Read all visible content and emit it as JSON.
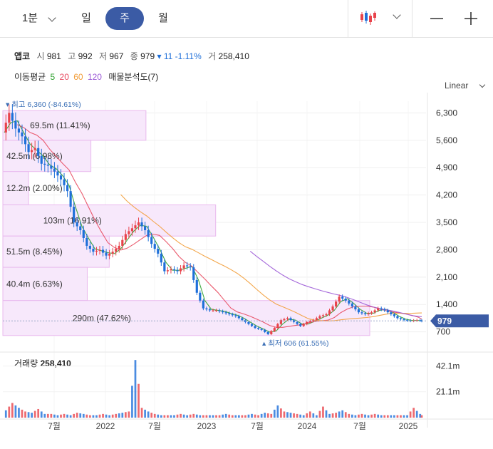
{
  "toolbar": {
    "interval_1m": "1분",
    "day": "일",
    "week": "주",
    "month": "월",
    "zoom_out": "—",
    "zoom_in": "+"
  },
  "stock": {
    "name": "앱코",
    "open_label": "시",
    "open": "981",
    "high_label": "고",
    "high": "992",
    "low_label": "저",
    "low": "967",
    "close_label": "종",
    "close": "979",
    "change": "▾ 11 -1.11%",
    "volume_label": "거",
    "volume": "258,410"
  },
  "ma": {
    "label": "이동평균",
    "periods": [
      {
        "value": "5",
        "color": "#2ca02c"
      },
      {
        "value": "20",
        "color": "#e84a5f"
      },
      {
        "value": "60",
        "color": "#f29d38"
      },
      {
        "value": "120",
        "color": "#9b59d6"
      }
    ],
    "profile_label": "매물분석도(7)"
  },
  "scale_mode": "Linear",
  "colors": {
    "up": "#e8434b",
    "down": "#1e6fd9",
    "profile": "#f7e8fb",
    "profile_border": "#e9b9ee",
    "accent": "#3b5ba5"
  },
  "chart_data": {
    "type": "candlestick",
    "x_ticks": [
      "7월",
      "2022",
      "7월",
      "2023",
      "7월",
      "2024",
      "7월",
      "2025"
    ],
    "price_axis": {
      "ticks": [
        "6,300",
        "5,600",
        "4,900",
        "4,200",
        "3,500",
        "2,800",
        "2,100",
        "1,400",
        "700"
      ],
      "ylim": [
        620,
        6600
      ]
    },
    "high_marker": {
      "text": "▾ 최고 6,360 (-84.61%)",
      "price": 6360
    },
    "low_marker": {
      "text": "▴ 최저 606 (61.55%)",
      "price": 606
    },
    "last_price": {
      "text": "979",
      "price": 979
    },
    "volume_profile": [
      {
        "label": "69.5m (11.41%)",
        "price_low": 5600,
        "price_high": 6360,
        "fraction": 0.39
      },
      {
        "label": "42.5m (6.98%)",
        "price_low": 4800,
        "price_high": 5600,
        "fraction": 0.24
      },
      {
        "label": "12.2m (2.00%)",
        "price_low": 3950,
        "price_high": 4800,
        "fraction": 0.07
      },
      {
        "label": "103m (16.91%)",
        "price_low": 3150,
        "price_high": 3950,
        "fraction": 0.58
      },
      {
        "label": "51.5m (8.45%)",
        "price_low": 2350,
        "price_high": 3150,
        "fraction": 0.29
      },
      {
        "label": "40.4m (6.63%)",
        "price_low": 1500,
        "price_high": 2350,
        "fraction": 0.23
      },
      {
        "label": "290m (47.62%)",
        "price_low": 606,
        "price_high": 1500,
        "fraction": 1.0
      }
    ],
    "price_series": [
      [
        0,
        5800
      ],
      [
        2,
        6300
      ],
      [
        4,
        5900
      ],
      [
        6,
        5700
      ],
      [
        8,
        5300
      ],
      [
        10,
        5400
      ],
      [
        12,
        5000
      ],
      [
        14,
        4950
      ],
      [
        16,
        4800
      ],
      [
        18,
        4600
      ],
      [
        20,
        4300
      ],
      [
        22,
        3500
      ],
      [
        24,
        3300
      ],
      [
        26,
        2900
      ],
      [
        28,
        2750
      ],
      [
        30,
        2800
      ],
      [
        32,
        2650
      ],
      [
        34,
        2750
      ],
      [
        36,
        2900
      ],
      [
        38,
        3200
      ],
      [
        40,
        3350
      ],
      [
        42,
        3500
      ],
      [
        44,
        3300
      ],
      [
        46,
        2950
      ],
      [
        48,
        2700
      ],
      [
        50,
        2250
      ],
      [
        52,
        2300
      ],
      [
        54,
        2250
      ],
      [
        56,
        2400
      ],
      [
        58,
        2350
      ],
      [
        60,
        1700
      ],
      [
        62,
        1300
      ],
      [
        64,
        1250
      ],
      [
        66,
        1250
      ],
      [
        68,
        1200
      ],
      [
        70,
        1150
      ],
      [
        72,
        1100
      ],
      [
        74,
        1000
      ],
      [
        76,
        900
      ],
      [
        78,
        800
      ],
      [
        80,
        750
      ],
      [
        82,
        640
      ],
      [
        84,
        800
      ],
      [
        86,
        1000
      ],
      [
        88,
        1050
      ],
      [
        90,
        950
      ],
      [
        92,
        850
      ],
      [
        94,
        950
      ],
      [
        96,
        1000
      ],
      [
        98,
        1100
      ],
      [
        100,
        1150
      ],
      [
        102,
        1350
      ],
      [
        104,
        1600
      ],
      [
        106,
        1500
      ],
      [
        108,
        1350
      ],
      [
        110,
        1200
      ],
      [
        112,
        1150
      ],
      [
        114,
        1200
      ],
      [
        116,
        1300
      ],
      [
        118,
        1250
      ],
      [
        120,
        1150
      ],
      [
        122,
        1050
      ],
      [
        124,
        1000
      ],
      [
        126,
        980
      ],
      [
        128,
        1000
      ],
      [
        129,
        979
      ]
    ],
    "volume_axis": {
      "ticks": [
        "42.1m",
        "21.1m"
      ],
      "ylim": [
        0,
        50
      ]
    },
    "volume_label": "거래량",
    "volume_value": "258,410",
    "volume_series": [
      [
        0,
        6
      ],
      [
        2,
        12
      ],
      [
        4,
        8
      ],
      [
        6,
        5
      ],
      [
        8,
        4
      ],
      [
        10,
        7
      ],
      [
        12,
        3
      ],
      [
        14,
        3
      ],
      [
        16,
        2
      ],
      [
        18,
        3
      ],
      [
        20,
        2
      ],
      [
        22,
        4
      ],
      [
        24,
        3
      ],
      [
        26,
        2
      ],
      [
        28,
        2
      ],
      [
        30,
        3
      ],
      [
        32,
        2
      ],
      [
        34,
        3
      ],
      [
        36,
        4
      ],
      [
        38,
        5
      ],
      [
        40,
        47
      ],
      [
        42,
        8
      ],
      [
        44,
        5
      ],
      [
        46,
        3
      ],
      [
        48,
        2
      ],
      [
        50,
        2
      ],
      [
        52,
        2
      ],
      [
        54,
        3
      ],
      [
        56,
        2
      ],
      [
        58,
        3
      ],
      [
        60,
        2
      ],
      [
        62,
        2
      ],
      [
        64,
        2
      ],
      [
        66,
        2
      ],
      [
        68,
        3
      ],
      [
        70,
        2
      ],
      [
        72,
        2
      ],
      [
        74,
        2
      ],
      [
        76,
        3
      ],
      [
        78,
        2
      ],
      [
        80,
        4
      ],
      [
        82,
        3
      ],
      [
        84,
        10
      ],
      [
        86,
        5
      ],
      [
        88,
        4
      ],
      [
        90,
        3
      ],
      [
        92,
        2
      ],
      [
        94,
        5
      ],
      [
        96,
        2
      ],
      [
        98,
        9
      ],
      [
        100,
        3
      ],
      [
        102,
        4
      ],
      [
        104,
        6
      ],
      [
        106,
        3
      ],
      [
        108,
        2
      ],
      [
        110,
        3
      ],
      [
        112,
        2
      ],
      [
        114,
        3
      ],
      [
        116,
        2
      ],
      [
        118,
        2
      ],
      [
        120,
        2
      ],
      [
        122,
        2
      ],
      [
        124,
        2
      ],
      [
        126,
        8
      ],
      [
        128,
        3
      ],
      [
        129,
        1
      ]
    ]
  }
}
